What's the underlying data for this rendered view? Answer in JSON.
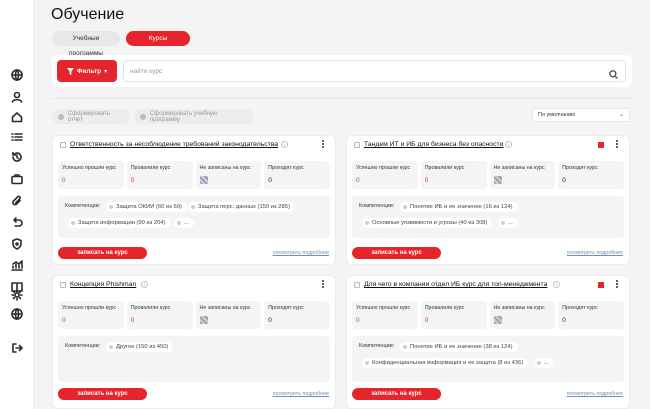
{
  "page": {
    "title": "Обучение"
  },
  "tabs": [
    {
      "label": "Учебные программы",
      "active": false
    },
    {
      "label": "Курсы",
      "active": true
    }
  ],
  "filter": {
    "button_label": "Фильтр",
    "search_placeholder": "найти курс"
  },
  "actions": {
    "report_label": "Сформировать отчет",
    "program_label": "Сформировать учебную программу",
    "sort_value": "По умолчанию"
  },
  "sidebar_icons": [
    "globe-icon",
    "user-icon",
    "home-icon",
    "list-icon",
    "history-icon",
    "briefcase-icon",
    "paperclip-icon",
    "undo-icon",
    "shield-icon",
    "analytics-icon",
    "book-icon",
    "settings-icon",
    "globe2-icon",
    "logout-icon"
  ],
  "stat_labels": {
    "passed": "Успешно прошли курс",
    "failed": "Провалили курс",
    "not_enrolled": "Не записаны на курс",
    "in_progress": "Проходят курс"
  },
  "competencies_label": "Компетенции:",
  "enroll_label": "записать на курс",
  "details_label": "посмотреть подробнее",
  "colors": {
    "accent": "#e5242b",
    "success": "#1a9e3f",
    "link": "#6f8fb8"
  },
  "courses": [
    {
      "title": "Ответственность за несоблюдение требований законодательства",
      "passed": "0",
      "failed": "0",
      "in_progress": "0",
      "chips": [
        "Защита ОКИИ (60 из 60)",
        "Защита перс. данных (150 из 285)",
        "Защита информации (90 из 204)",
        "..."
      ]
    },
    {
      "title": "Тандем ИТ и ИБ для бизнеса без опасности",
      "passed": "0",
      "failed": "0",
      "in_progress": "0",
      "chips": [
        "Понятие ИБ и ее значение (16 из 124)",
        "Основные уязвимости и угрозы (40 из 308)",
        "..."
      ]
    },
    {
      "title": "Концепция Phishman",
      "passed": "0",
      "failed": "0",
      "in_progress": "0",
      "chips": [
        "Другое (150 из 450)"
      ]
    },
    {
      "title": "Для чего в компании отдел ИБ курс для топ-менеджмента",
      "passed": "0",
      "failed": "0",
      "in_progress": "0",
      "chips": [
        "Понятие ИБ и ее значение (38 из 124)",
        "Конфиденциальная информация и ее защита (8 из 436)",
        "..."
      ]
    }
  ]
}
